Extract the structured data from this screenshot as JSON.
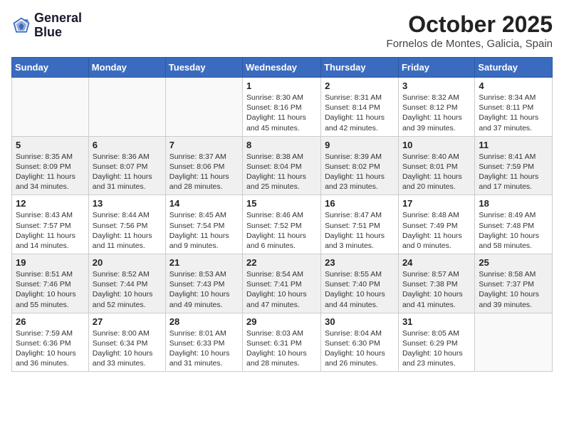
{
  "header": {
    "logo_line1": "General",
    "logo_line2": "Blue",
    "month": "October 2025",
    "location": "Fornelos de Montes, Galicia, Spain"
  },
  "weekdays": [
    "Sunday",
    "Monday",
    "Tuesday",
    "Wednesday",
    "Thursday",
    "Friday",
    "Saturday"
  ],
  "weeks": [
    [
      {
        "day": "",
        "info": ""
      },
      {
        "day": "",
        "info": ""
      },
      {
        "day": "",
        "info": ""
      },
      {
        "day": "1",
        "info": "Sunrise: 8:30 AM\nSunset: 8:16 PM\nDaylight: 11 hours\nand 45 minutes."
      },
      {
        "day": "2",
        "info": "Sunrise: 8:31 AM\nSunset: 8:14 PM\nDaylight: 11 hours\nand 42 minutes."
      },
      {
        "day": "3",
        "info": "Sunrise: 8:32 AM\nSunset: 8:12 PM\nDaylight: 11 hours\nand 39 minutes."
      },
      {
        "day": "4",
        "info": "Sunrise: 8:34 AM\nSunset: 8:11 PM\nDaylight: 11 hours\nand 37 minutes."
      }
    ],
    [
      {
        "day": "5",
        "info": "Sunrise: 8:35 AM\nSunset: 8:09 PM\nDaylight: 11 hours\nand 34 minutes."
      },
      {
        "day": "6",
        "info": "Sunrise: 8:36 AM\nSunset: 8:07 PM\nDaylight: 11 hours\nand 31 minutes."
      },
      {
        "day": "7",
        "info": "Sunrise: 8:37 AM\nSunset: 8:06 PM\nDaylight: 11 hours\nand 28 minutes."
      },
      {
        "day": "8",
        "info": "Sunrise: 8:38 AM\nSunset: 8:04 PM\nDaylight: 11 hours\nand 25 minutes."
      },
      {
        "day": "9",
        "info": "Sunrise: 8:39 AM\nSunset: 8:02 PM\nDaylight: 11 hours\nand 23 minutes."
      },
      {
        "day": "10",
        "info": "Sunrise: 8:40 AM\nSunset: 8:01 PM\nDaylight: 11 hours\nand 20 minutes."
      },
      {
        "day": "11",
        "info": "Sunrise: 8:41 AM\nSunset: 7:59 PM\nDaylight: 11 hours\nand 17 minutes."
      }
    ],
    [
      {
        "day": "12",
        "info": "Sunrise: 8:43 AM\nSunset: 7:57 PM\nDaylight: 11 hours\nand 14 minutes."
      },
      {
        "day": "13",
        "info": "Sunrise: 8:44 AM\nSunset: 7:56 PM\nDaylight: 11 hours\nand 11 minutes."
      },
      {
        "day": "14",
        "info": "Sunrise: 8:45 AM\nSunset: 7:54 PM\nDaylight: 11 hours\nand 9 minutes."
      },
      {
        "day": "15",
        "info": "Sunrise: 8:46 AM\nSunset: 7:52 PM\nDaylight: 11 hours\nand 6 minutes."
      },
      {
        "day": "16",
        "info": "Sunrise: 8:47 AM\nSunset: 7:51 PM\nDaylight: 11 hours\nand 3 minutes."
      },
      {
        "day": "17",
        "info": "Sunrise: 8:48 AM\nSunset: 7:49 PM\nDaylight: 11 hours\nand 0 minutes."
      },
      {
        "day": "18",
        "info": "Sunrise: 8:49 AM\nSunset: 7:48 PM\nDaylight: 10 hours\nand 58 minutes."
      }
    ],
    [
      {
        "day": "19",
        "info": "Sunrise: 8:51 AM\nSunset: 7:46 PM\nDaylight: 10 hours\nand 55 minutes."
      },
      {
        "day": "20",
        "info": "Sunrise: 8:52 AM\nSunset: 7:44 PM\nDaylight: 10 hours\nand 52 minutes."
      },
      {
        "day": "21",
        "info": "Sunrise: 8:53 AM\nSunset: 7:43 PM\nDaylight: 10 hours\nand 49 minutes."
      },
      {
        "day": "22",
        "info": "Sunrise: 8:54 AM\nSunset: 7:41 PM\nDaylight: 10 hours\nand 47 minutes."
      },
      {
        "day": "23",
        "info": "Sunrise: 8:55 AM\nSunset: 7:40 PM\nDaylight: 10 hours\nand 44 minutes."
      },
      {
        "day": "24",
        "info": "Sunrise: 8:57 AM\nSunset: 7:38 PM\nDaylight: 10 hours\nand 41 minutes."
      },
      {
        "day": "25",
        "info": "Sunrise: 8:58 AM\nSunset: 7:37 PM\nDaylight: 10 hours\nand 39 minutes."
      }
    ],
    [
      {
        "day": "26",
        "info": "Sunrise: 7:59 AM\nSunset: 6:36 PM\nDaylight: 10 hours\nand 36 minutes."
      },
      {
        "day": "27",
        "info": "Sunrise: 8:00 AM\nSunset: 6:34 PM\nDaylight: 10 hours\nand 33 minutes."
      },
      {
        "day": "28",
        "info": "Sunrise: 8:01 AM\nSunset: 6:33 PM\nDaylight: 10 hours\nand 31 minutes."
      },
      {
        "day": "29",
        "info": "Sunrise: 8:03 AM\nSunset: 6:31 PM\nDaylight: 10 hours\nand 28 minutes."
      },
      {
        "day": "30",
        "info": "Sunrise: 8:04 AM\nSunset: 6:30 PM\nDaylight: 10 hours\nand 26 minutes."
      },
      {
        "day": "31",
        "info": "Sunrise: 8:05 AM\nSunset: 6:29 PM\nDaylight: 10 hours\nand 23 minutes."
      },
      {
        "day": "",
        "info": ""
      }
    ]
  ],
  "shaded_rows": [
    1,
    3
  ]
}
